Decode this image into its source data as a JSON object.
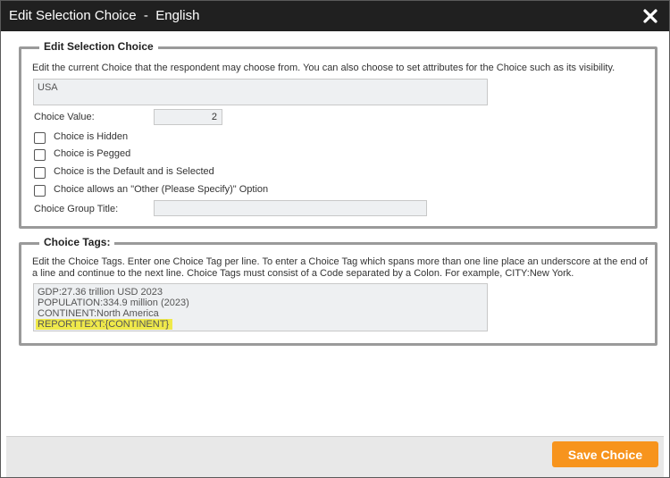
{
  "dialog": {
    "title": "Edit Selection Choice  -  English",
    "close_icon": "close-icon"
  },
  "choice_section": {
    "legend": "Edit Selection Choice",
    "description": "Edit the current Choice that the respondent may choose from. You can also choose to set attributes for the Choice such as its visibility.",
    "choice_text": "USA",
    "value_label": "Choice Value:",
    "value": "2",
    "checkboxes": [
      {
        "label": "Choice is Hidden",
        "checked": false
      },
      {
        "label": "Choice is Pegged",
        "checked": false
      },
      {
        "label": "Choice is the Default and is Selected",
        "checked": false
      },
      {
        "label": "Choice allows an \"Other (Please Specify)\" Option",
        "checked": false
      }
    ],
    "group_title_label": "Choice Group Title:",
    "group_title_value": ""
  },
  "tags_section": {
    "legend": "Choice Tags:",
    "description": "Edit the Choice Tags. Enter one Choice Tag per line. To enter a Choice Tag which spans more than one line place an underscore at the end of a line and continue to the next line. Choice Tags must consist of a Code separated by a Colon. For example, CITY:New York.",
    "lines": [
      "GDP:27.36 trillion USD 2023",
      "POPULATION:334.9 million (2023)",
      "CONTINENT:North America",
      "REPORTTEXT:{CONTINENT}"
    ],
    "highlight_color": "#efe94a"
  },
  "footer": {
    "save_label": "Save Choice",
    "save_color": "#f7941d"
  }
}
